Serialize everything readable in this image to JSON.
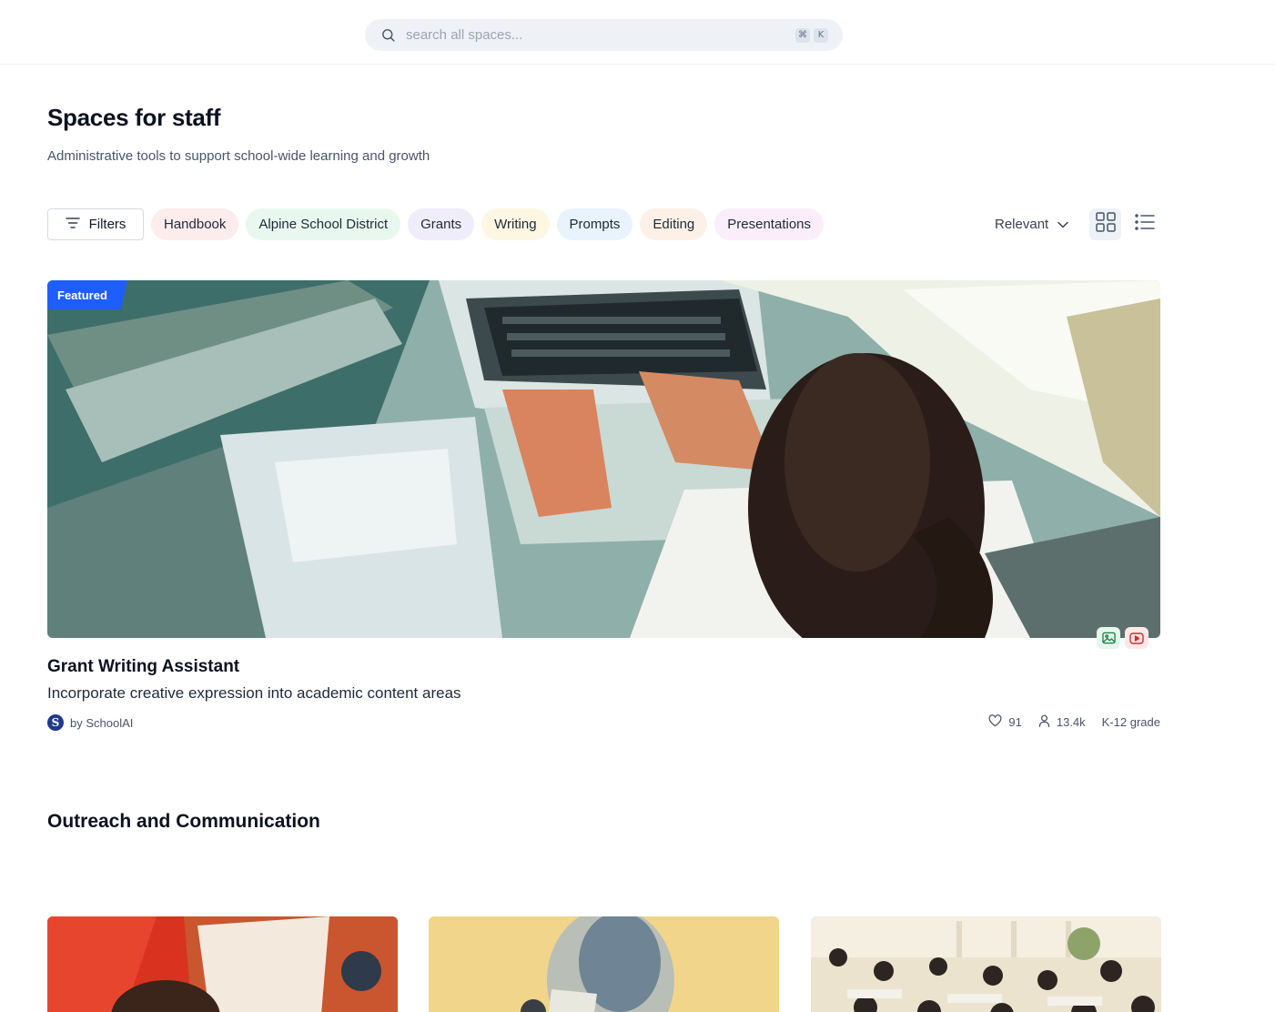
{
  "search": {
    "placeholder": "search all spaces...",
    "shortcut_mod": "⌘",
    "shortcut_key": "K"
  },
  "page": {
    "title": "Spaces for staff",
    "subtitle": "Administrative tools to support school-wide learning and growth"
  },
  "filters": {
    "button_label": "Filters",
    "chips": [
      {
        "label": "Handbook",
        "color": "#fdecec"
      },
      {
        "label": "Alpine School District",
        "color": "#e9f8ef"
      },
      {
        "label": "Grants",
        "color": "#efedfb"
      },
      {
        "label": "Writing",
        "color": "#fdf6e3"
      },
      {
        "label": "Prompts",
        "color": "#e8f3fd"
      },
      {
        "label": "Editing",
        "color": "#fdf1e7"
      },
      {
        "label": "Presentations",
        "color": "#fbeefa"
      }
    ],
    "sort_label": "Relevant"
  },
  "featured": {
    "badge": "Featured",
    "title": "Grant Writing Assistant",
    "description": "Incorporate creative expression into academic content areas",
    "author": "by SchoolAI",
    "author_initial": "S",
    "likes": "91",
    "users": "13.4k",
    "grade": "K-12 grade",
    "media_icons": [
      "image-icon",
      "video-icon"
    ]
  },
  "section": {
    "title": "Outreach and Communication"
  },
  "colors": {
    "accent": "#1e5eff",
    "text": "#0b1220",
    "muted": "#475569"
  }
}
